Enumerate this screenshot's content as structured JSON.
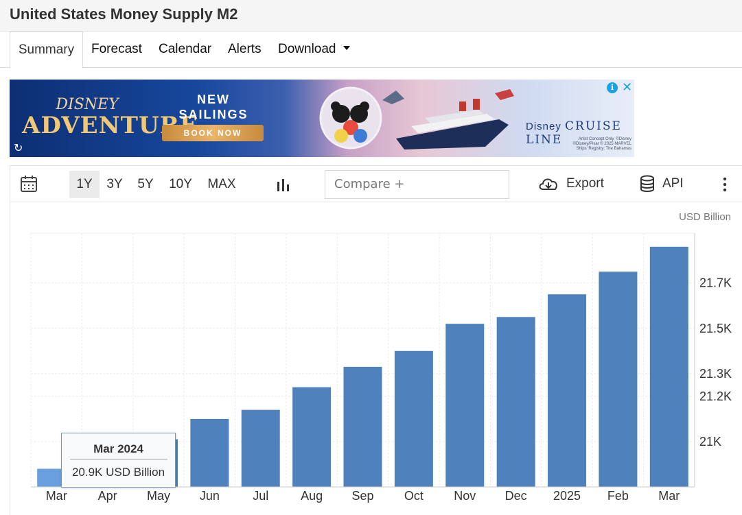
{
  "page": {
    "title": "United States Money Supply M2"
  },
  "tabs": [
    {
      "label": "Summary",
      "active": true
    },
    {
      "label": "Forecast"
    },
    {
      "label": "Calendar"
    },
    {
      "label": "Alerts"
    },
    {
      "label": "Download"
    }
  ],
  "ad": {
    "logo_top": "DISNEY",
    "logo_main": "ADVENTURE",
    "headline": "NEW SAILINGS AVAILABLE",
    "cta": "BOOK NOW",
    "brand_prefix": "Disney",
    "brand_main": "CRUISE LINE",
    "fine_print": "Artist Concept Only. ©Disney ©Disney/Pixar © 2025 MARVEL Ships' Registry: The Bahamas"
  },
  "toolbar": {
    "ranges": [
      "1Y",
      "3Y",
      "5Y",
      "10Y",
      "MAX"
    ],
    "active_range": "1Y",
    "compare_placeholder": "Compare +",
    "export_label": "Export",
    "api_label": "API"
  },
  "tooltip": {
    "date": "Mar 2024",
    "value": "20.9K USD Billion"
  },
  "colors": {
    "bar": "#4f81bd",
    "bar_highlight": "#6a9fdd",
    "accent": "#1aa3e0"
  },
  "chart_data": {
    "type": "bar",
    "unit_label": "USD Billion",
    "categories": [
      "Mar",
      "Apr",
      "May",
      "Jun",
      "Jul",
      "Aug",
      "Sep",
      "Oct",
      "Nov",
      "Dec",
      "2025",
      "Feb",
      "Mar"
    ],
    "values": [
      20880,
      20970,
      21010,
      21100,
      21140,
      21240,
      21330,
      21400,
      21520,
      21550,
      21650,
      21750,
      21860
    ],
    "ylim": [
      20800,
      21920
    ],
    "yticks": [
      21000,
      21200,
      21300,
      21500,
      21700
    ],
    "ytick_labels": [
      "21K",
      "21.2K",
      "21.3K",
      "21.5K",
      "21.7K"
    ],
    "highlighted_index": 0,
    "grid": true
  }
}
